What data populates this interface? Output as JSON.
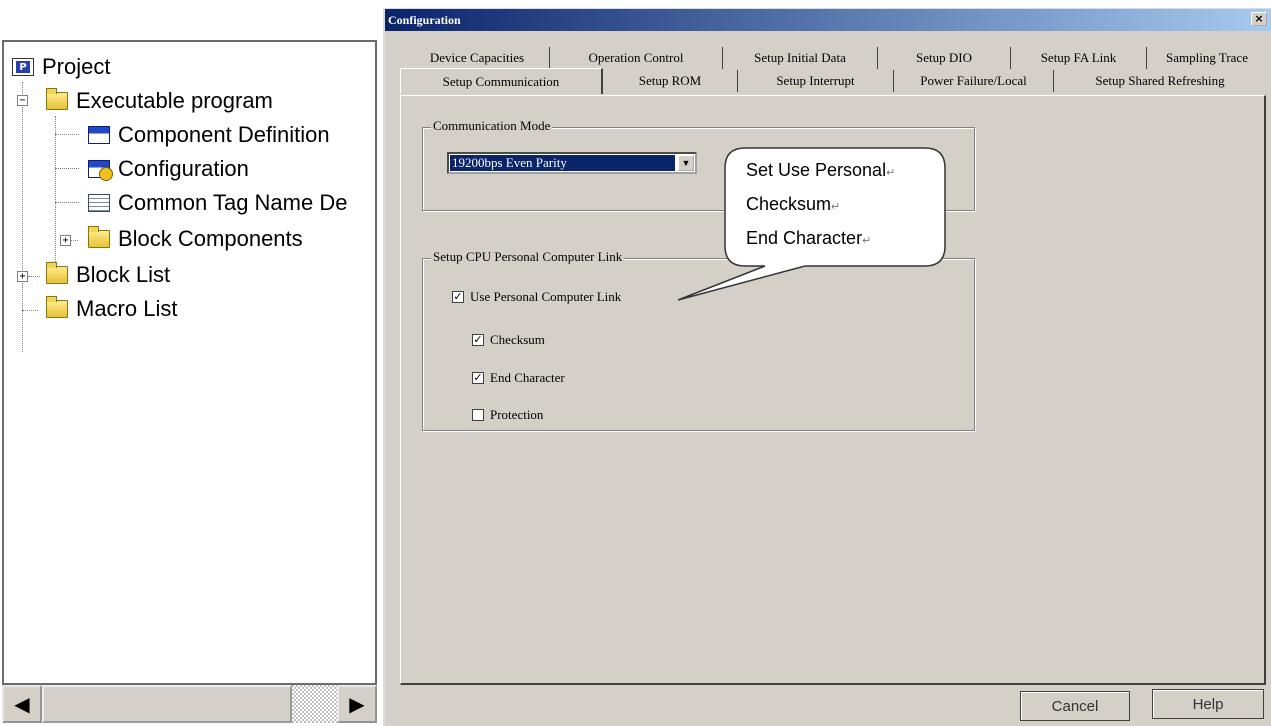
{
  "tree": {
    "items": [
      {
        "label": "Project",
        "icon": "project-icon"
      },
      {
        "label": "Executable program",
        "icon": "folder-icon"
      },
      {
        "label": "Component Definition",
        "icon": "component-definition-icon"
      },
      {
        "label": "Configuration",
        "icon": "configuration-icon"
      },
      {
        "label": "Common Tag Name De",
        "icon": "tag-table-icon"
      },
      {
        "label": "Block Components",
        "icon": "folder-icon"
      },
      {
        "label": "Block List",
        "icon": "folder-icon"
      },
      {
        "label": "Macro List",
        "icon": "folder-icon"
      }
    ],
    "scroll_left": "◀",
    "scroll_right": "▶"
  },
  "dialog": {
    "title": "Configuration",
    "close": "×",
    "tabs_row1": [
      "Device Capacities",
      "Operation Control",
      "Setup Initial Data",
      "Setup DIO",
      "Setup FA Link",
      "Sampling Trace"
    ],
    "tabs_row2": [
      "Setup Communication",
      "Setup ROM",
      "Setup Interrupt",
      "Power Failure/Local",
      "Setup Shared Refreshing"
    ],
    "active_tab": "Setup Communication",
    "communication_mode": {
      "title": "Communication Mode",
      "value": "19200bps Even Parity",
      "arrow": "▼"
    },
    "pc_link": {
      "title": "Setup CPU Personal Computer Link",
      "use_link": {
        "label": "Use Personal Computer Link",
        "checked": true
      },
      "checksum": {
        "label": "Checksum",
        "checked": true
      },
      "end_char": {
        "label": "End Character",
        "checked": true
      },
      "protection": {
        "label": "Protection",
        "checked": false
      }
    },
    "check_mark": "✓",
    "buttons": {
      "cancel": "Cancel",
      "help": "Help"
    }
  },
  "callout": {
    "line1": "Set Use Personal",
    "line2": "Checksum",
    "line3": "End Character",
    "return_mark": "↵"
  }
}
